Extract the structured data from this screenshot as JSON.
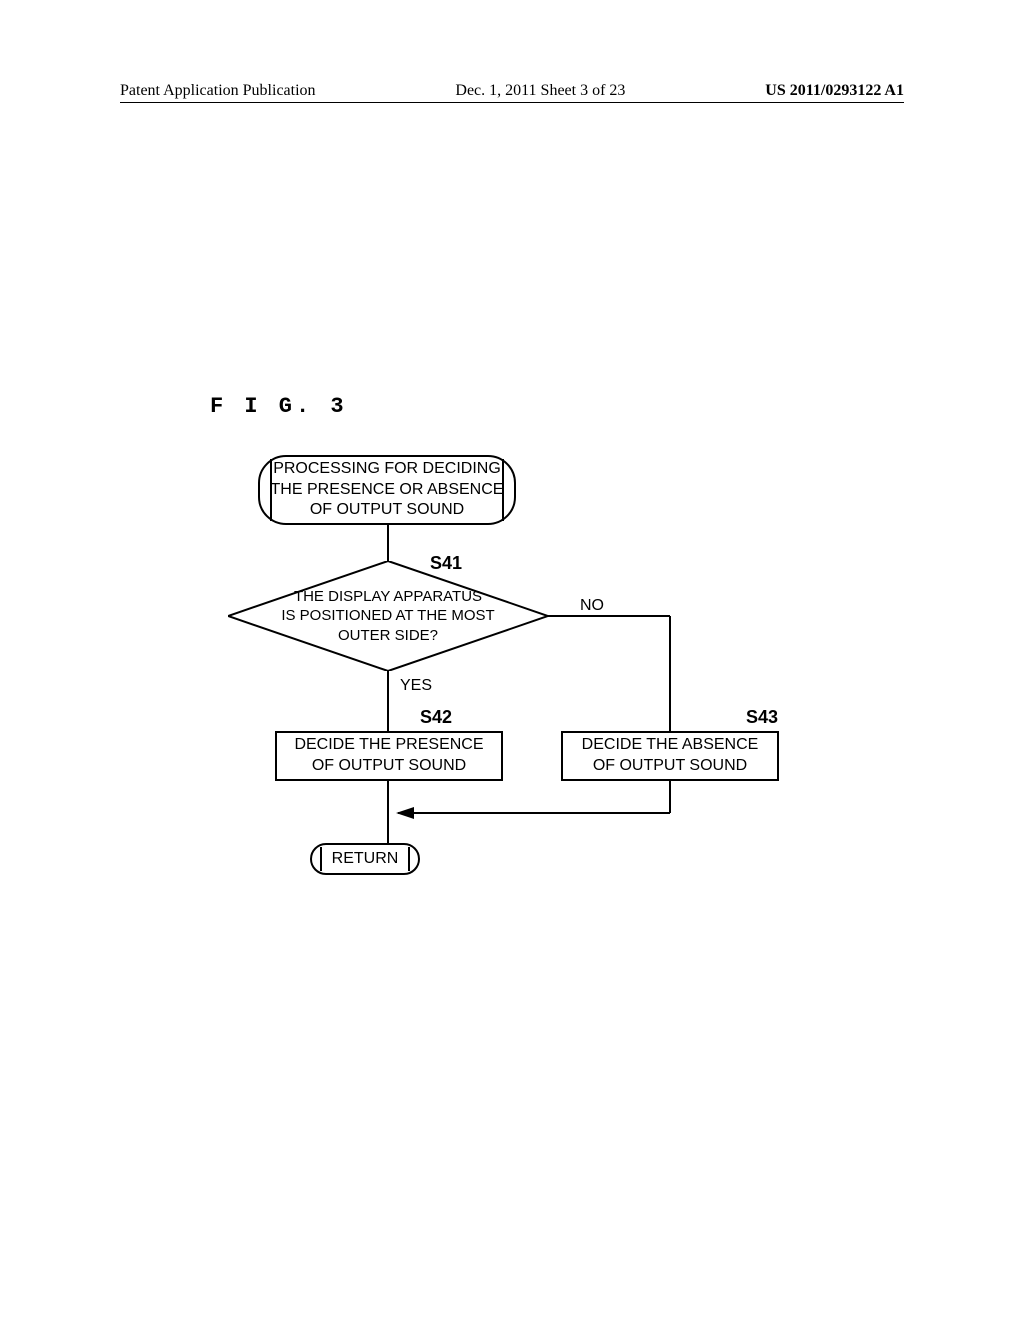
{
  "header": {
    "left": "Patent Application Publication",
    "center": "Dec. 1, 2011   Sheet 3 of 23",
    "right": "US 2011/0293122 A1"
  },
  "figure_label": "F I G.  3",
  "flowchart": {
    "start": {
      "line1": "PROCESSING FOR DECIDING",
      "line2": "THE PRESENCE OR ABSENCE",
      "line3": "OF OUTPUT SOUND"
    },
    "decision": {
      "step": "S41",
      "line1": "THE DISPLAY APPARATUS",
      "line2": "IS POSITIONED AT THE MOST",
      "line3": "OUTER SIDE?",
      "yes": "YES",
      "no": "NO"
    },
    "s42": {
      "step": "S42",
      "line1": "DECIDE THE PRESENCE",
      "line2": "OF OUTPUT SOUND"
    },
    "s43": {
      "step": "S43",
      "line1": "DECIDE THE ABSENCE",
      "line2": "OF OUTPUT SOUND"
    },
    "return": "RETURN"
  }
}
